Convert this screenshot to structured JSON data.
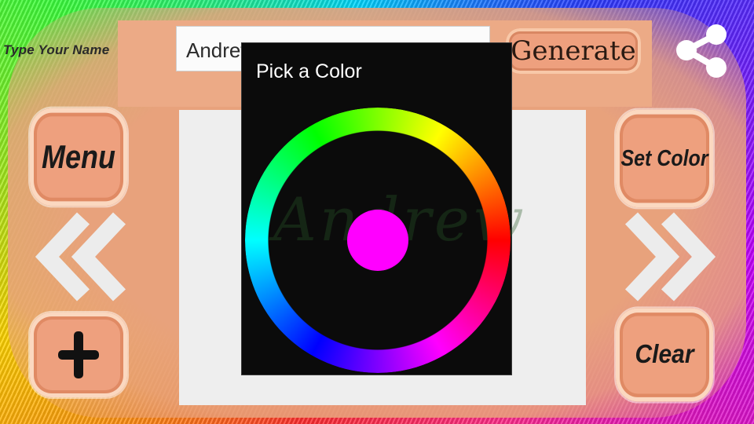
{
  "header": {
    "name_label": "Type Your Name",
    "name_value": "Andrew",
    "generate_label": "Generate"
  },
  "left_buttons": {
    "menu_label": "Menu"
  },
  "right_buttons": {
    "set_color_label": "Set Color",
    "clear_label": "Clear"
  },
  "icons": {
    "share": "share-icon",
    "previous": "double-chevron-left-icon",
    "next": "double-chevron-right-icon",
    "add": "plus-icon"
  },
  "dialog": {
    "title": "Pick a Color",
    "selected_color": "#ff00ff"
  }
}
